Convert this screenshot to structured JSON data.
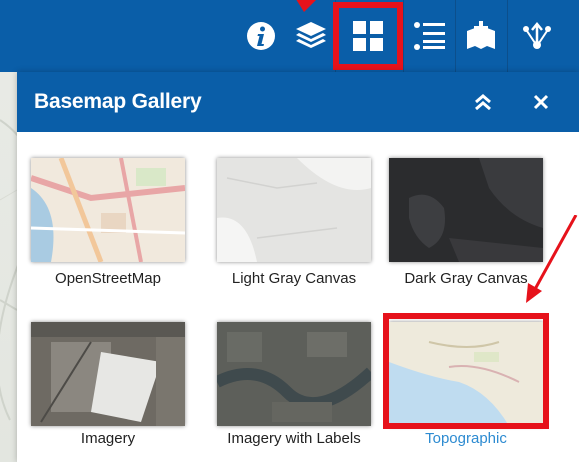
{
  "toolbar": {
    "tools": [
      {
        "name": "info",
        "icon": "info-icon"
      },
      {
        "name": "layers",
        "icon": "layers-icon"
      },
      {
        "name": "basemap-gallery",
        "icon": "grid-icon",
        "active": true
      },
      {
        "name": "legend",
        "icon": "list-icon"
      },
      {
        "name": "add-data",
        "icon": "map-add-icon"
      },
      {
        "name": "share",
        "icon": "share-icon"
      }
    ],
    "highlight_color": "#e6121b"
  },
  "panel": {
    "title": "Basemap Gallery",
    "collapse_icon": "double-chevron-up-icon",
    "close_icon": "close-icon"
  },
  "basemaps": [
    {
      "label": "OpenStreetMap",
      "selected": false
    },
    {
      "label": "Light Gray Canvas",
      "selected": false
    },
    {
      "label": "Dark Gray Canvas",
      "selected": false
    },
    {
      "label": "Imagery",
      "selected": false
    },
    {
      "label": "Imagery with Labels",
      "selected": false
    },
    {
      "label": "Topographic",
      "selected": true
    }
  ],
  "colors": {
    "header_blue": "#0a5ea8",
    "selected_label": "#2d8bd1",
    "annotation_red": "#e6121b"
  }
}
